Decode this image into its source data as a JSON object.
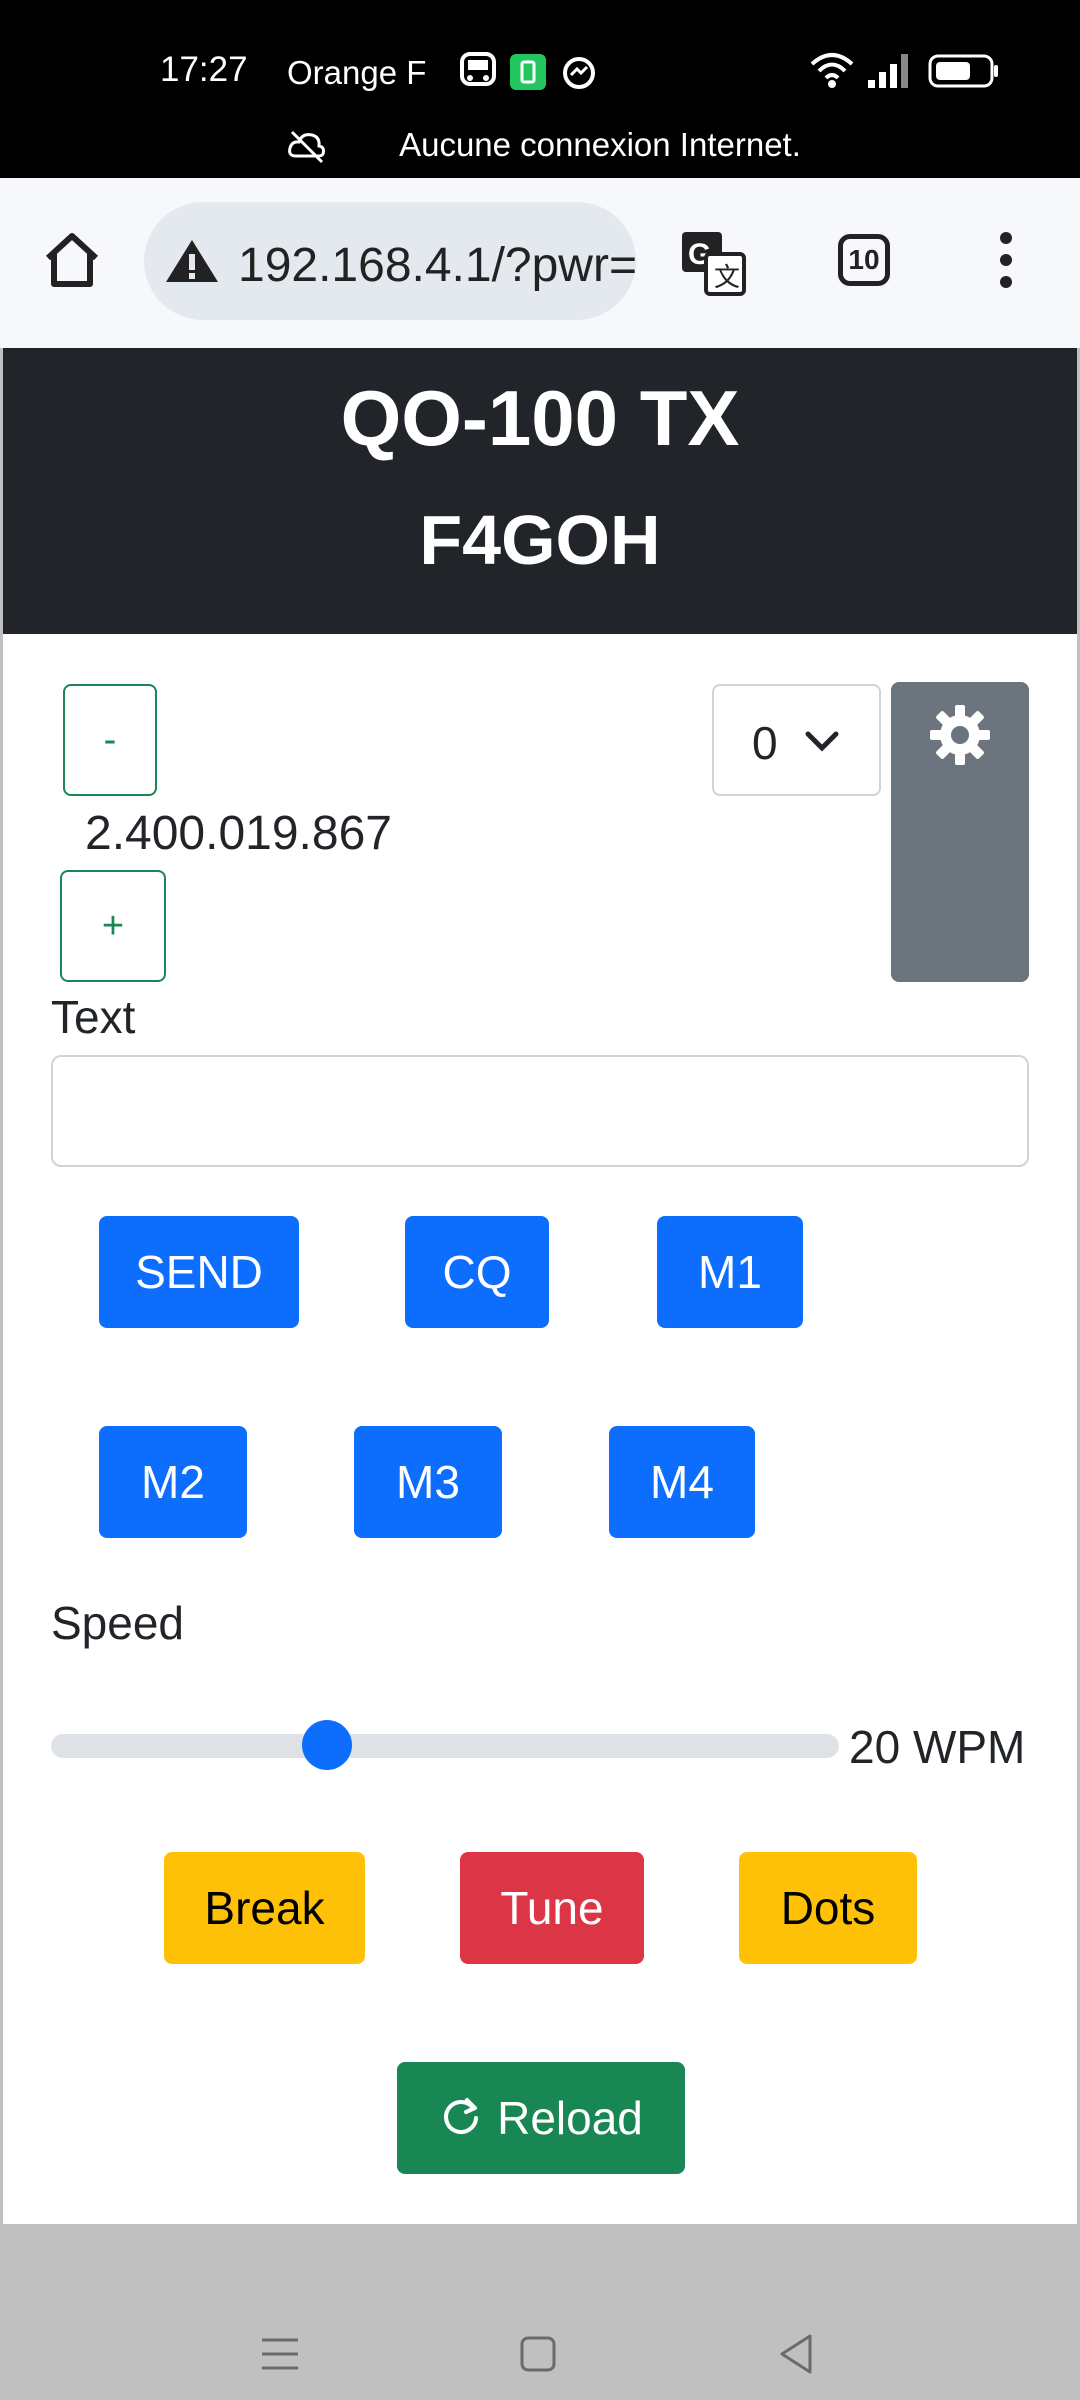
{
  "status_bar": {
    "time": "17:27",
    "carrier": "Orange F",
    "no_connection": "Aucune connexion Internet."
  },
  "browser": {
    "url": "192.168.4.1/?pwr=",
    "tab_count": "10"
  },
  "header": {
    "title": "QO-100 TX",
    "callsign": "F4GOH"
  },
  "frequency": {
    "minus_label": "-",
    "value": "2.400.019.867",
    "plus_label": "+"
  },
  "power_select": {
    "value": "0"
  },
  "text": {
    "label": "Text",
    "value": ""
  },
  "macros": {
    "send": "SEND",
    "cq": "CQ",
    "m1": "M1",
    "m2": "M2",
    "m3": "M3",
    "m4": "M4"
  },
  "speed": {
    "label": "Speed",
    "value_label": "20 WPM",
    "fraction": 0.34
  },
  "actions": {
    "break": "Break",
    "tune": "Tune",
    "dots": "Dots",
    "reload": "Reload"
  },
  "colors": {
    "primary": "#0d6efd",
    "success": "#198754",
    "warning": "#ffc107",
    "danger": "#dc3545",
    "secondary": "#6c757d",
    "dark": "#212529"
  }
}
